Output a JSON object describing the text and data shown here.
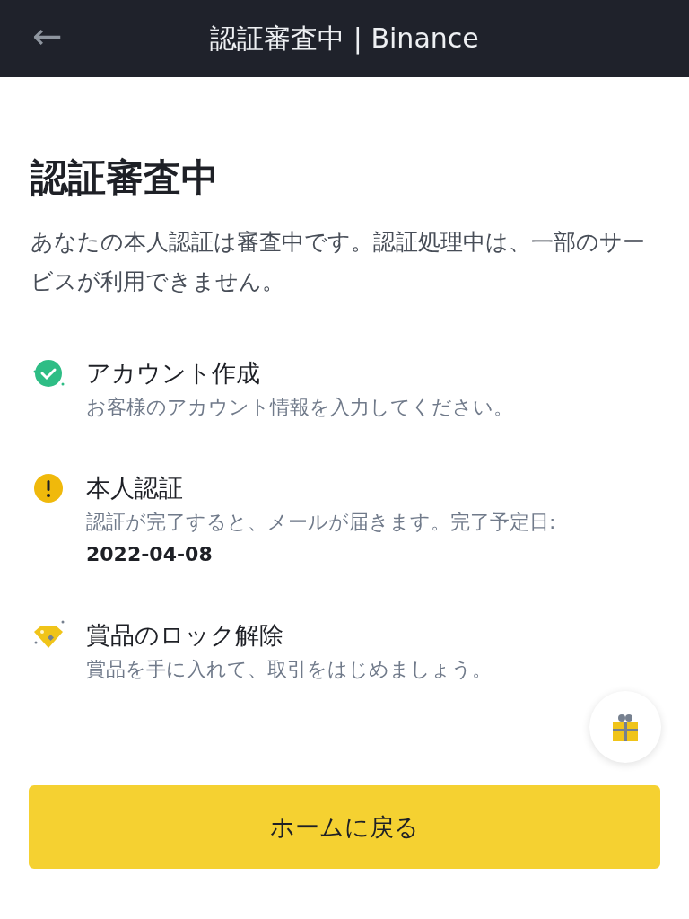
{
  "header": {
    "back": "←",
    "title": "認証審査中 | Binance"
  },
  "title": "認証審査中",
  "description": "あなたの本人認証は審査中です。認証処理中は、一部のサービスが利用できません。",
  "steps": [
    {
      "kind": "done",
      "title": "アカウント作成",
      "text": "お客様のアカウント情報を入力してください。"
    },
    {
      "kind": "pending",
      "title": "本人認証",
      "text": "認証が完了すると、メールが届きます。完了予定日:",
      "date": "2022-04-08"
    },
    {
      "kind": "reward",
      "title": "賞品のロック解除",
      "text": "賞品を手に入れて、取引をはじめましょう。"
    }
  ],
  "button": "ホームに戻る"
}
